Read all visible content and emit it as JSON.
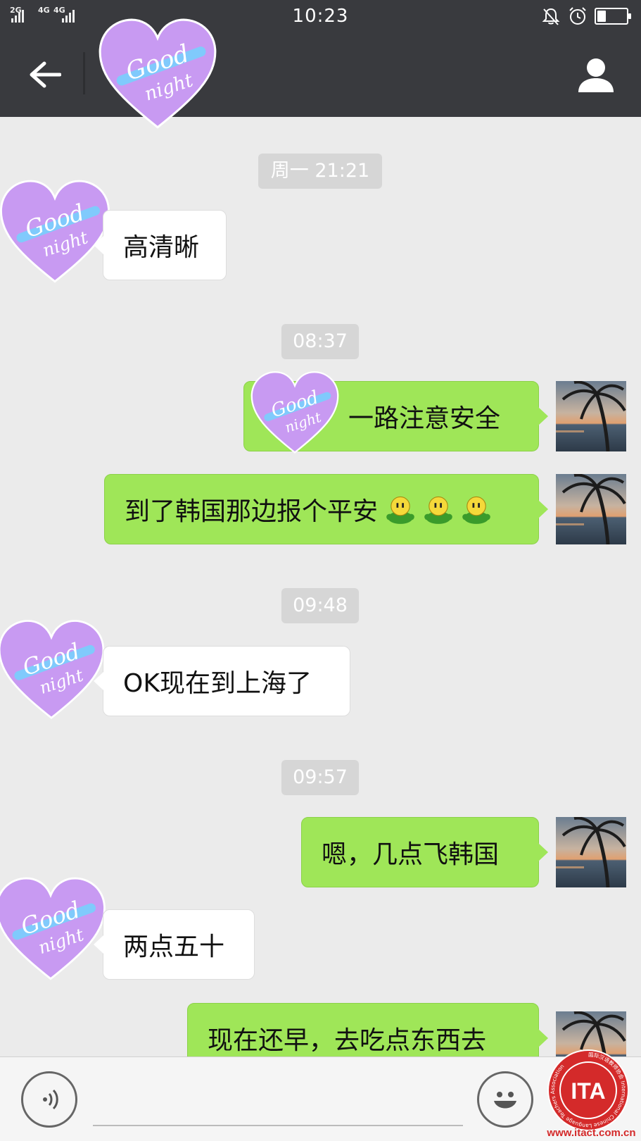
{
  "status_bar": {
    "network_1": "2G",
    "network_2": "4G",
    "network_3": "4G",
    "time": "10:23",
    "battery_level": 0.3,
    "icons": [
      "mute-bell-icon",
      "alarm-icon",
      "battery-icon"
    ]
  },
  "header": {
    "back_icon": "arrow-left-icon",
    "profile_icon": "person-icon",
    "contact_avatar_text": "Good night"
  },
  "messages": [
    {
      "type": "timestamp",
      "text": "周一 21:21"
    },
    {
      "type": "incoming",
      "text": "高清晰"
    },
    {
      "type": "timestamp",
      "text": "08:37"
    },
    {
      "type": "outgoing",
      "text": "一路注意安全"
    },
    {
      "type": "outgoing",
      "text": "到了韩国那边报个平安",
      "emoji_count": 3
    },
    {
      "type": "timestamp",
      "text": "09:48"
    },
    {
      "type": "incoming",
      "text": "OK现在到上海了"
    },
    {
      "type": "timestamp",
      "text": "09:57"
    },
    {
      "type": "outgoing",
      "text": "嗯，几点飞韩国"
    },
    {
      "type": "incoming",
      "text": "两点五十"
    },
    {
      "type": "outgoing",
      "text": "现在还早，去吃点东西去"
    }
  ],
  "input_bar": {
    "voice_icon": "voice-icon",
    "emoji_icon": "smiley-icon"
  },
  "watermark": {
    "seal_text": "ITA",
    "seal_ring_text": "国际汉语教师协会 International Chinese Language Teachers Association",
    "url": "www.itact.com.cn"
  },
  "colors": {
    "header_bg": "#393a3e",
    "chat_bg": "#ebebeb",
    "outgoing_bubble": "#9fe658",
    "incoming_bubble": "#ffffff",
    "timestamp_bg": "#d6d6d6",
    "heart_purple": "#c89af2",
    "seal_red": "#d42a2a"
  }
}
